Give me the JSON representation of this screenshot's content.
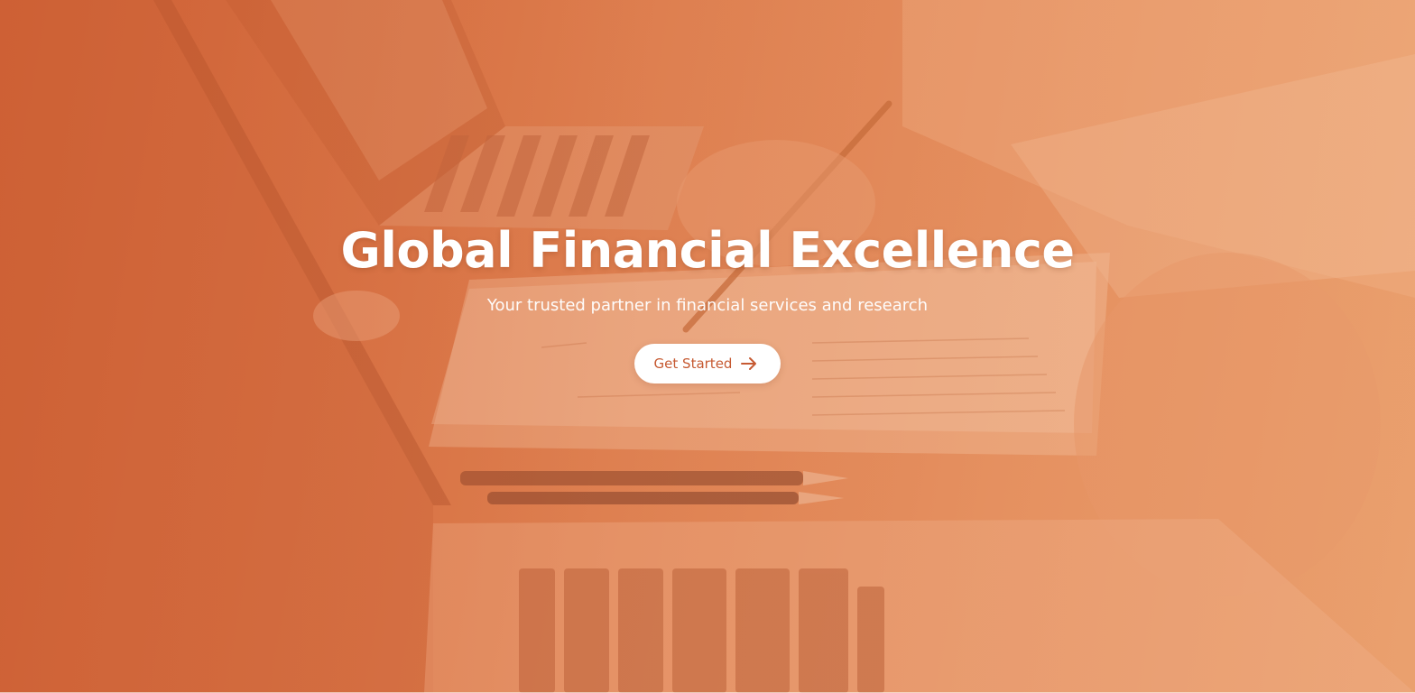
{
  "hero": {
    "title": "Global Financial Excellence",
    "subtitle": "Your trusted partner in financial services and research",
    "cta_label": "Get Started",
    "cta_icon": "arrow-right-icon"
  },
  "colors": {
    "accent": "#c65a32",
    "overlay": "#d9733f",
    "text": "#ffffff",
    "button_bg": "#ffffff"
  }
}
